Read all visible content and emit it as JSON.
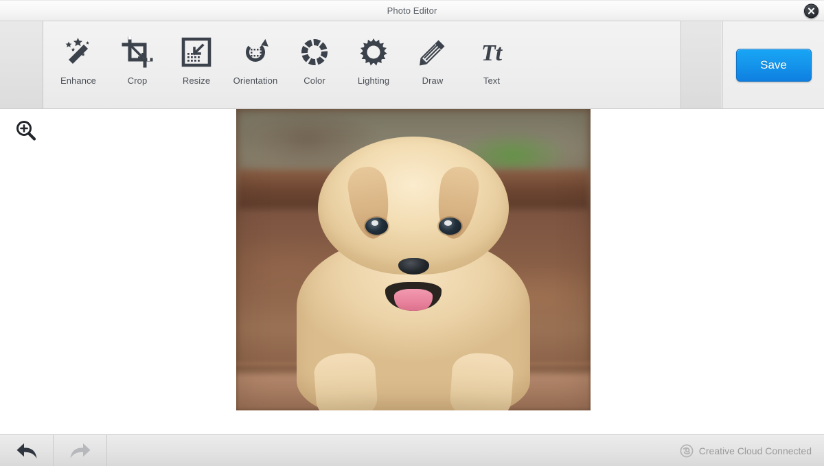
{
  "window": {
    "title": "Photo Editor",
    "close_icon": "close-x-icon"
  },
  "toolbar": {
    "tools": [
      {
        "id": "enhance",
        "label": "Enhance",
        "icon": "magic-wand-icon"
      },
      {
        "id": "crop",
        "label": "Crop",
        "icon": "crop-icon"
      },
      {
        "id": "resize",
        "label": "Resize",
        "icon": "resize-icon"
      },
      {
        "id": "orientation",
        "label": "Orientation",
        "icon": "rotate-icon"
      },
      {
        "id": "color",
        "label": "Color",
        "icon": "color-wheel-icon"
      },
      {
        "id": "lighting",
        "label": "Lighting",
        "icon": "sun-icon"
      },
      {
        "id": "draw",
        "label": "Draw",
        "icon": "pencil-icon"
      },
      {
        "id": "text",
        "label": "Text",
        "icon": "text-tt-icon"
      }
    ],
    "save_label": "Save",
    "save_color": "#1596ec"
  },
  "canvas": {
    "zoom_tool_icon": "zoom-in-magnifier-icon",
    "photo_alt": "golden retriever puppy sitting on a stone ledge"
  },
  "bottom_bar": {
    "undo_icon": "undo-arrow-icon",
    "redo_icon": "redo-arrow-icon",
    "undo_enabled": "true",
    "redo_enabled": "false",
    "status_icon": "creative-cloud-icon",
    "status_text": "Creative Cloud Connected"
  },
  "colors": {
    "accent": "#1596ec",
    "icon": "#3c424b",
    "label": "#4a4f56",
    "status": "#9a9a9a"
  }
}
